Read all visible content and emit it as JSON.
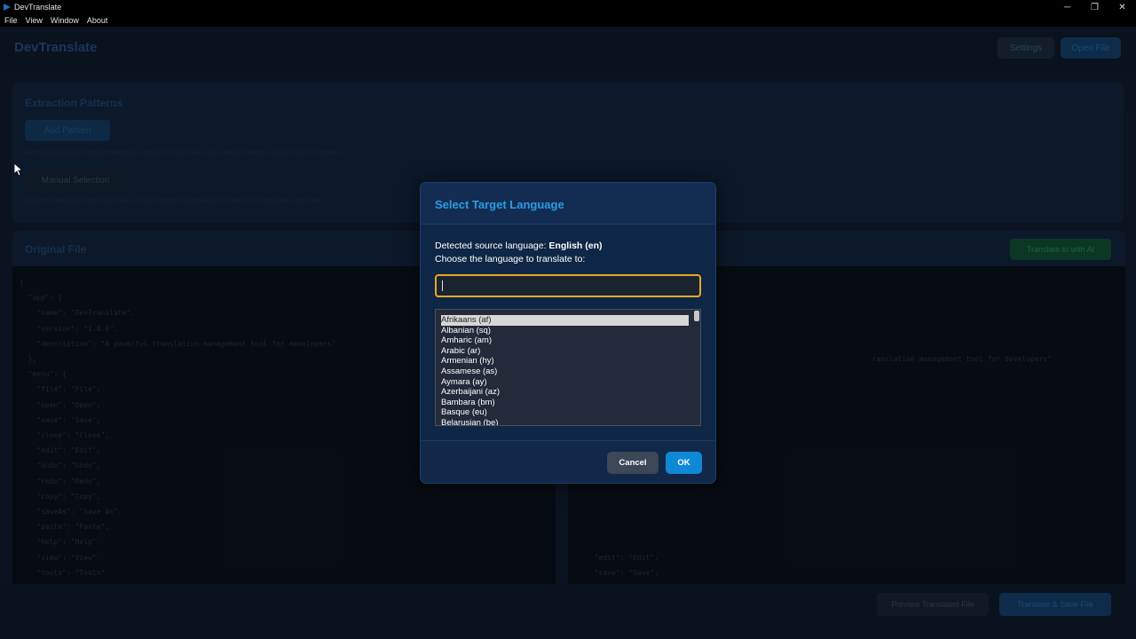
{
  "window": {
    "title": "DevTranslate",
    "controls": {
      "minimize": "─",
      "restore": "❐",
      "close": "✕"
    }
  },
  "menubar": {
    "items": [
      "File",
      "View",
      "Window",
      "About"
    ]
  },
  "background": {
    "app_title": "DevTranslate",
    "header_buttons": {
      "settings": "Settings",
      "open_file": "Open File"
    },
    "top_panel": {
      "title": "Extraction Patterns",
      "add_button": "Add Pattern",
      "note": "Automatically find and extract translatable strings from your files using common patterns such as t() or i18n patterns.",
      "manual_button": "Manual Selection",
      "note2": "Select text manually in the file preview and mark strings that should be included in the translation output file."
    },
    "left_panel": {
      "title": "Original File",
      "code": "{\n  \"app\": {\n    \"name\": \"DevTranslate\",\n    \"version\": \"1.0.0\",\n    \"description\": \"A powerful translation management tool for developers\"\n  },\n  \"menu\": {\n    \"file\": \"File\",\n    \"open\": \"Open\",\n    \"save\": \"Save\",\n    \"close\": \"Close\",\n    \"edit\": \"Edit\",\n    \"undo\": \"Undo\",\n    \"redo\": \"Redo\",\n    \"copy\": \"Copy\",\n    \"saveAs\": \"Save As\",\n    \"paste\": \"Paste\",\n    \"help\": \"Help\",\n    \"view\": \"View\",\n    \"tools\": \"Tools\""
    },
    "right_panel": {
      "translate_button": "Translate to with AI",
      "code": "\n\n\n\n\n                                                                   ranslation management tool for developers\"\n\n\n\n\n\n\n\n\n\n\n\n\n  \"edit\": \"Edit\",\n  \"save\": \"Save\",\n  \"saveAs\": \"Save As\",\n  \"close\": \"Close\",\n  \"redo\": \"Redo\",\n  \"undo\": \"Undo\","
    },
    "footer": {
      "preview_button": "Preview Translated File",
      "save_button": "Translate & Save File"
    }
  },
  "dialog": {
    "title": "Select Target Language",
    "detected_label": "Detected source language: ",
    "detected_value": "English (en)",
    "choose_label": "Choose the language to translate to:",
    "search_value": "",
    "languages": [
      "Afrikaans (af)",
      "Albanian (sq)",
      "Amharic (am)",
      "Arabic (ar)",
      "Armenian (hy)",
      "Assamese (as)",
      "Aymara (ay)",
      "Azerbaijani (az)",
      "Bambara (bm)",
      "Basque (eu)",
      "Belarusian (be)"
    ],
    "selected_language": "Afrikaans (af)",
    "cancel_label": "Cancel",
    "ok_label": "OK"
  },
  "colors": {
    "accent": "#2b9be6",
    "ok_button": "#0f88d6",
    "cancel_button": "#3c4757",
    "search_focus_border": "#e4a927",
    "dialog_bg": "#0f2746"
  }
}
